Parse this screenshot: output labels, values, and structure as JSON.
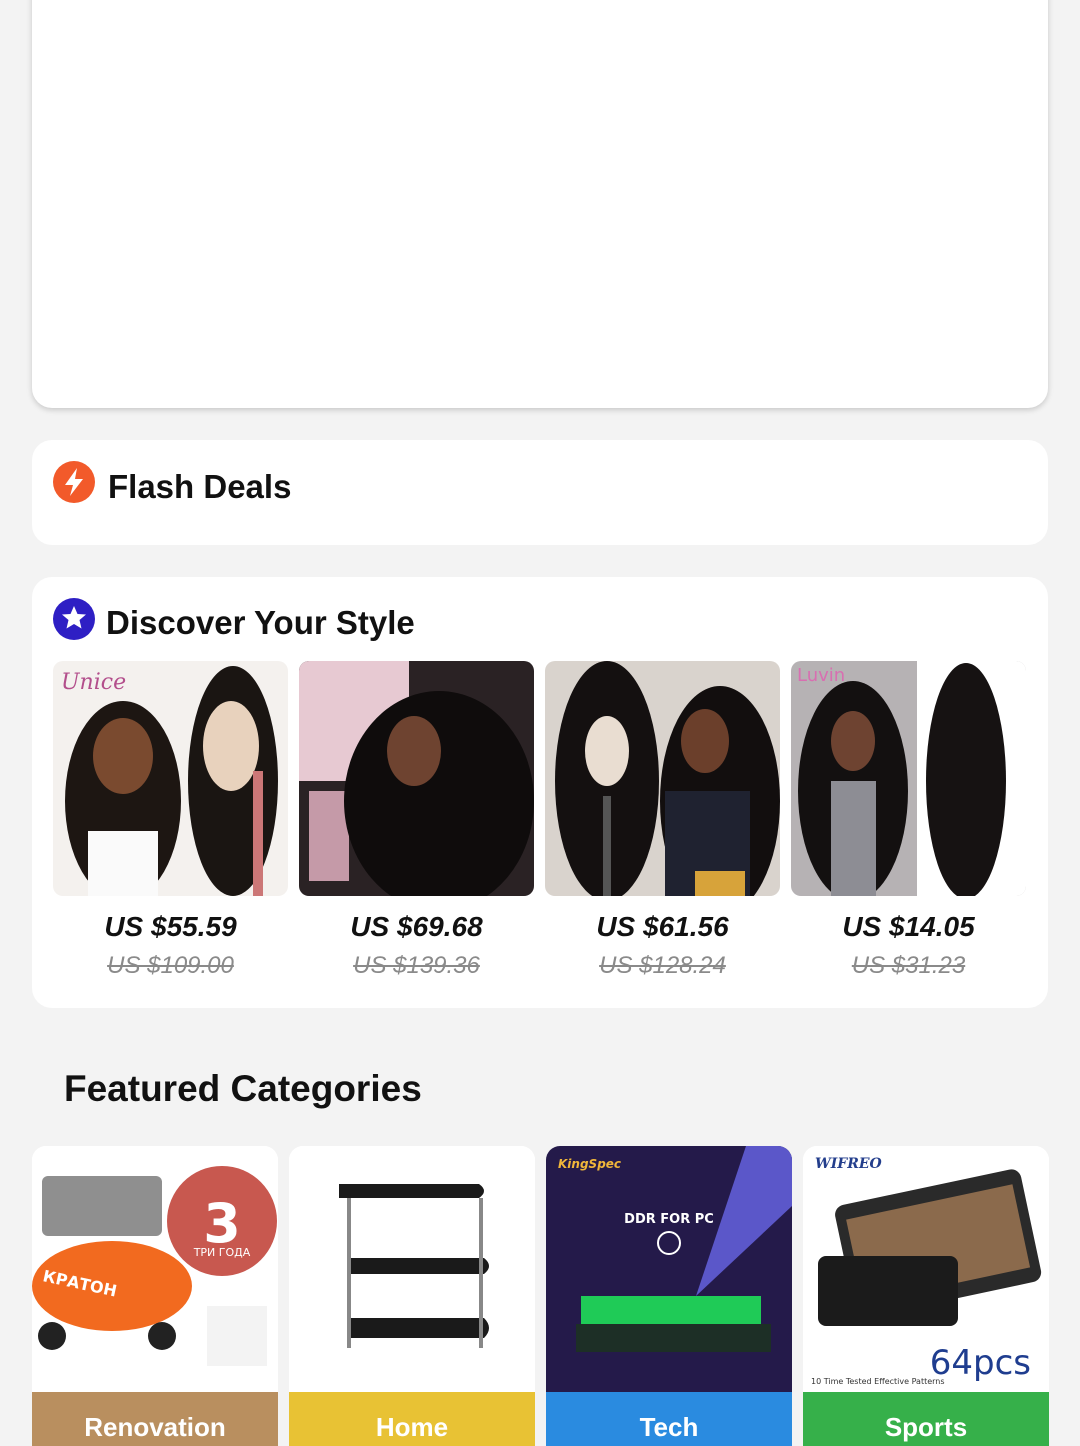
{
  "flash_deals": {
    "title": "Flash Deals"
  },
  "discover": {
    "title": "Discover Your Style",
    "products": [
      {
        "price": "US $55.59",
        "old_price": "US $109.00",
        "brand_mark": "Unice"
      },
      {
        "price": "US $69.68",
        "old_price": "US $139.36",
        "brand_mark": ""
      },
      {
        "price": "US $61.56",
        "old_price": "US $128.24",
        "brand_mark": ""
      },
      {
        "price": "US $14.05",
        "old_price": "US $31.23",
        "brand_mark": "Luvin"
      }
    ]
  },
  "featured": {
    "title": "Featured Categories",
    "categories": [
      {
        "label": "Renovation",
        "color": "#b98f5f",
        "pic_text_1": "КРАТОН",
        "pic_text_2": "3",
        "pic_text_3": "ТРИ ГОДА"
      },
      {
        "label": "Home",
        "color": "#e8c234"
      },
      {
        "label": "Tech",
        "color": "#2a8be0",
        "pic_text_1": "KingSpec",
        "pic_text_2": "DDR FOR PC"
      },
      {
        "label": "Sports",
        "color": "#36b04a",
        "pic_text_1": "WIFREO",
        "pic_text_2": "64pcs",
        "pic_text_3": "10 Time Tested Effective Patterns"
      }
    ]
  },
  "colors": {
    "flash_icon": "#f25a2a",
    "style_icon": "#2e1fc4"
  }
}
